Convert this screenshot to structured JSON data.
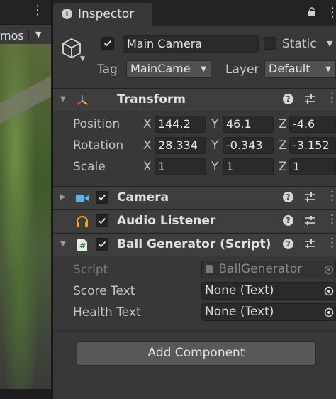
{
  "scene": {
    "gizmos_label": "mos"
  },
  "inspector": {
    "tab_label": "Inspector"
  },
  "gameobject": {
    "active": true,
    "name": "Main Camera",
    "static_label": "Static",
    "static": false,
    "tag_label": "Tag",
    "tag_value": "MainCame",
    "layer_label": "Layer",
    "layer_value": "Default"
  },
  "transform": {
    "title": "Transform",
    "position": {
      "label": "Position",
      "x": "144.2",
      "y": "46.1",
      "z": "-4.6"
    },
    "rotation": {
      "label": "Rotation",
      "x": "28.334",
      "y": "-0.343",
      "z": "-3.152"
    },
    "scale": {
      "label": "Scale",
      "x": "1",
      "y": "1",
      "z": "1"
    },
    "axis_labels": {
      "x": "X",
      "y": "Y",
      "z": "Z"
    }
  },
  "components": {
    "camera": {
      "title": "Camera",
      "enabled": true
    },
    "audio_listener": {
      "title": "Audio Listener",
      "enabled": true
    },
    "ball_generator": {
      "title": "Ball Generator (Script)",
      "enabled": true,
      "script_label": "Script",
      "script_value": "BallGenerator",
      "score_text_label": "Score Text",
      "score_text_value": "None (Text)",
      "health_text_label": "Health Text",
      "health_text_value": "None (Text)"
    }
  },
  "buttons": {
    "add_component": "Add Component"
  },
  "icons": {
    "tab": "info-icon",
    "lock": "lock-icon",
    "gameobject": "cube-icon",
    "transform": "transform-gizmo-icon",
    "camera": "video-camera-icon",
    "audio_listener": "headphones-icon",
    "script": "script-icon",
    "help": "help-icon",
    "presets": "sliders-icon",
    "menu": "kebab-menu-icon",
    "picker": "object-picker-icon"
  },
  "colors": {
    "panel_bg": "#383838",
    "header_bg": "#3e3e3e",
    "field_bg": "#2a2a2a",
    "button_bg": "#585858",
    "camera_icon": "#5ab4f0",
    "audio_icon": "#f2a52a",
    "transform_blue": "#3a8ee6",
    "transform_red": "#e8532e",
    "transform_yellow": "#f0c230"
  }
}
